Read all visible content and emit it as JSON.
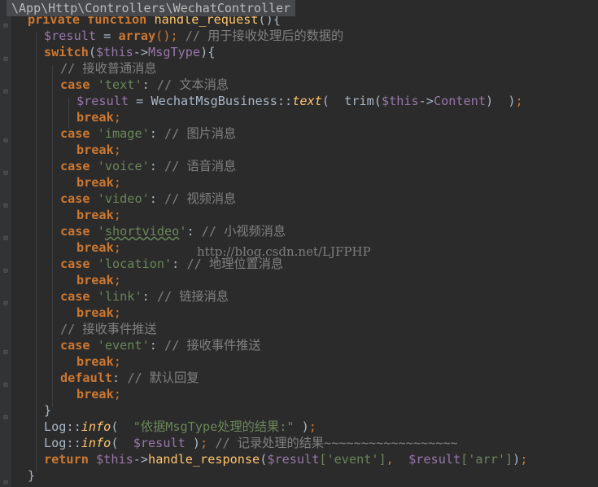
{
  "breadcrumb": "\\App\\Http\\Controllers\\WechatController",
  "watermark": "http://blog.csdn.net/LJFPHP",
  "code": {
    "l0": {
      "kw1": "private",
      "kw2": "function",
      "name": "handle_request",
      "rest": "(){"
    },
    "l1": {
      "v": "$result",
      "op": " = ",
      "kw": "array",
      "p": "();",
      "c": " // 用于接收处理后的数据的"
    },
    "l2": {
      "kw": "switch",
      "a": "(",
      "v": "$this",
      "arrow": "->",
      "prop": "MsgType",
      "b": "){"
    },
    "l3": {
      "c": "// 接收普通消息"
    },
    "l4": {
      "kw": "case",
      "s": "'text'",
      "colon": ":",
      "c": " // 文本消息"
    },
    "l5": {
      "v": "$result",
      "op": " = ",
      "cls": "WechatMsgBusiness",
      "dc": "::",
      "m": "text",
      "a": "(  trim(",
      "v2": "$this",
      "arrow": "->",
      "prop": "Content",
      "b": ")  )",
      "semi": ";"
    },
    "l6": {
      "kw": "break",
      "semi": ";"
    },
    "l7": {
      "kw": "case",
      "s": "'image'",
      "colon": ":",
      "c": " // 图片消息"
    },
    "l8": {
      "kw": "break",
      "semi": ";"
    },
    "l9": {
      "kw": "case",
      "s": "'voice'",
      "colon": ":",
      "c": " // 语音消息"
    },
    "l10": {
      "kw": "break",
      "semi": ";"
    },
    "l11": {
      "kw": "case",
      "s": "'video'",
      "colon": ":",
      "c": " // 视频消息"
    },
    "l12": {
      "kw": "break",
      "semi": ";"
    },
    "l13": {
      "kw": "case",
      "s1": "'",
      "s": "shortvideo",
      "s2": "'",
      "colon": ":",
      "c": " // 小视频消息"
    },
    "l14": {
      "kw": "break",
      "semi": ";"
    },
    "l15": {
      "kw": "case",
      "s": "'location'",
      "colon": ":",
      "c": " // 地理位置消息"
    },
    "l16": {
      "kw": "break",
      "semi": ";"
    },
    "l17": {
      "kw": "case",
      "s": "'link'",
      "colon": ":",
      "c": " // 链接消息"
    },
    "l18": {
      "kw": "break",
      "semi": ";"
    },
    "l19": {
      "c": "// 接收事件推送"
    },
    "l20": {
      "kw": "case",
      "s": "'event'",
      "colon": ":",
      "c": " // 接收事件推送"
    },
    "l21": {
      "kw": "break",
      "semi": ";"
    },
    "l22": {
      "kw": "default",
      "colon": ":",
      "c": " // 默认回复"
    },
    "l23": {
      "kw": "break",
      "semi": ";"
    },
    "l24": {
      "t": "}"
    },
    "l25": {
      "cls": "Log",
      "dc": "::",
      "m": "info",
      "a": "(  ",
      "s": "\"依据MsgType处理的结果:\"",
      "b": " )",
      "semi": ";"
    },
    "l26": {
      "cls": "Log",
      "dc": "::",
      "m": "info",
      "a": "(  ",
      "v": "$result",
      "b": " )",
      "semi": ";",
      "c": " // 记录处理的结果~~~~~~~~~~~~~~~~~~"
    },
    "l27": {
      "kw": "return",
      "sp": " ",
      "v": "$this",
      "arrow": "->",
      "fn": "handle_response",
      "a": "(",
      "v2": "$result",
      "k1": "['event']",
      "comma": ",",
      "sp2": "  ",
      "v3": "$result",
      "k2": "['arr']",
      "b": ")",
      "semi": ";"
    },
    "l28": {
      "t": "}"
    }
  }
}
